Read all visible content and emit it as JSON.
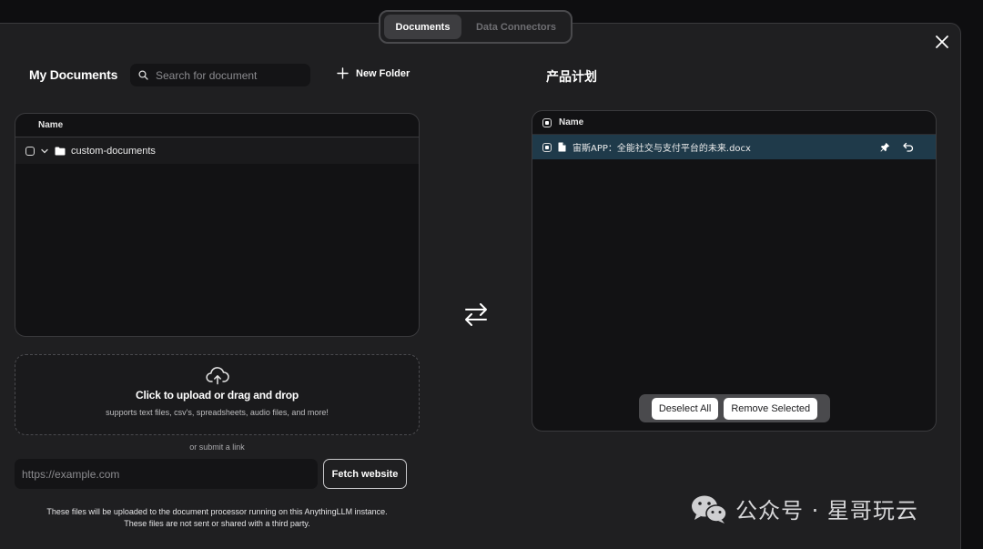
{
  "tabs": [
    {
      "label": "Documents",
      "active": true
    },
    {
      "label": "Data Connectors",
      "active": false
    }
  ],
  "my_documents": {
    "title": "My Documents",
    "search_placeholder": "Search for document",
    "new_folder_label": "New Folder",
    "table_header": "Name",
    "folders": [
      {
        "name": "custom-documents",
        "checked": false,
        "expanded": true
      }
    ]
  },
  "upload": {
    "title": "Click to upload or drag and drop",
    "subtitle": "supports text files, csv's, spreadsheets, audio files, and more!",
    "or_link": "or submit a link",
    "url_placeholder": "https://example.com",
    "fetch_label": "Fetch website",
    "disclaimer_line1": "These files will be uploaded to the document processor running on this AnythingLLM instance.",
    "disclaimer_line2": "These files are not sent or shared with a third party."
  },
  "workspace": {
    "title": "产品计划",
    "table_header": "Name",
    "files": [
      {
        "name": "宙斯APP：全能社交与支付平台的未来.docx",
        "selected": true
      }
    ],
    "deselect_all_label": "Deselect All",
    "remove_selected_label": "Remove Selected"
  },
  "watermark": {
    "text": "公众号 · 星哥玩云",
    "icon": "wechat-icon"
  },
  "colors": {
    "background": "#0e0e10",
    "modal": "#1f1f21",
    "selected_row": "#1f3a4a",
    "table_bg": "#121214"
  }
}
